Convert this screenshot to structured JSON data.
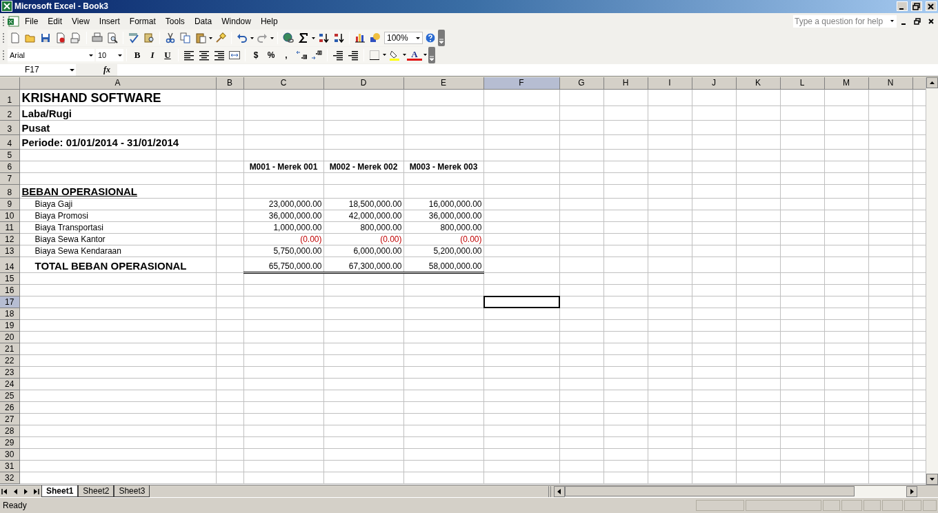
{
  "window": {
    "title": "Microsoft Excel - Book3"
  },
  "menu": [
    {
      "label": "File"
    },
    {
      "label": "Edit"
    },
    {
      "label": "View"
    },
    {
      "label": "Insert"
    },
    {
      "label": "Format"
    },
    {
      "label": "Tools"
    },
    {
      "label": "Data"
    },
    {
      "label": "Window"
    },
    {
      "label": "Help"
    }
  ],
  "help_box": {
    "placeholder": "Type a question for help"
  },
  "standard_toolbar": {
    "zoom": "100%"
  },
  "formatting_toolbar": {
    "font": "Arial",
    "size": "10",
    "buttons": [
      {
        "label": "B",
        "kind": "bold"
      },
      {
        "label": "I",
        "kind": "italic"
      },
      {
        "label": "U",
        "kind": "underline"
      },
      {
        "label": "$",
        "kind": "plain"
      },
      {
        "label": "%",
        "kind": "plain"
      },
      {
        "label": ",",
        "kind": "plain"
      },
      {
        "label": "A",
        "kind": "font_color"
      }
    ]
  },
  "formula_bar": {
    "name_box": "F17",
    "function_label": "fx"
  },
  "sheet": {
    "columns": [
      {
        "label": "A",
        "selected": false
      },
      {
        "label": "B",
        "selected": false
      },
      {
        "label": "C",
        "selected": false
      },
      {
        "label": "D",
        "selected": false
      },
      {
        "label": "E",
        "selected": false
      },
      {
        "label": "F",
        "selected": true
      },
      {
        "label": "G",
        "selected": false
      },
      {
        "label": "H",
        "selected": false
      },
      {
        "label": "I",
        "selected": false
      },
      {
        "label": "J",
        "selected": false
      },
      {
        "label": "K",
        "selected": false
      },
      {
        "label": "L",
        "selected": false
      },
      {
        "label": "M",
        "selected": false
      },
      {
        "label": "N",
        "selected": false
      }
    ],
    "rows": [
      {
        "number": "1",
        "kind": "title",
        "selected": false,
        "label": "KRISHAND SOFTWARE"
      },
      {
        "number": "2",
        "kind": "subtitle",
        "selected": false,
        "label": "Laba/Rugi"
      },
      {
        "number": "3",
        "kind": "subtitle",
        "selected": false,
        "label": "Pusat"
      },
      {
        "number": "4",
        "kind": "subtitle",
        "selected": false,
        "label": "Periode: 01/01/2014 - 31/01/2014"
      },
      {
        "number": "5",
        "kind": "empty",
        "selected": false
      },
      {
        "number": "6",
        "kind": "brand_header",
        "selected": false,
        "values": [
          {
            "text": "M001 - Merek 001",
            "negative": false
          },
          {
            "text": "M002 - Merek 002",
            "negative": false
          },
          {
            "text": "M003 - Merek 003",
            "negative": false
          }
        ]
      },
      {
        "number": "7",
        "kind": "empty",
        "selected": false
      },
      {
        "number": "8",
        "kind": "section",
        "selected": false,
        "label": "BEBAN OPERASIONAL"
      },
      {
        "number": "9",
        "kind": "item",
        "selected": false,
        "label": "Biaya Gaji",
        "values": [
          {
            "text": "23,000,000.00",
            "negative": false
          },
          {
            "text": "18,500,000.00",
            "negative": false
          },
          {
            "text": "16,000,000.00",
            "negative": false
          }
        ]
      },
      {
        "number": "10",
        "kind": "item",
        "selected": false,
        "label": "Biaya Promosi",
        "values": [
          {
            "text": "36,000,000.00",
            "negative": false
          },
          {
            "text": "42,000,000.00",
            "negative": false
          },
          {
            "text": "36,000,000.00",
            "negative": false
          }
        ]
      },
      {
        "number": "11",
        "kind": "item",
        "selected": false,
        "label": "Biaya Transportasi",
        "values": [
          {
            "text": "1,000,000.00",
            "negative": false
          },
          {
            "text": "800,000.00",
            "negative": false
          },
          {
            "text": "800,000.00",
            "negative": false
          }
        ]
      },
      {
        "number": "12",
        "kind": "item",
        "selected": false,
        "label": "Biaya Sewa Kantor",
        "values": [
          {
            "text": "(0.00)",
            "negative": true
          },
          {
            "text": "(0.00)",
            "negative": true
          },
          {
            "text": "(0.00)",
            "negative": true
          }
        ]
      },
      {
        "number": "13",
        "kind": "item",
        "selected": false,
        "label": "Biaya Sewa Kendaraan",
        "values": [
          {
            "text": "5,750,000.00",
            "negative": false
          },
          {
            "text": "6,000,000.00",
            "negative": false
          },
          {
            "text": "5,200,000.00",
            "negative": false
          }
        ]
      },
      {
        "number": "14",
        "kind": "total",
        "selected": false,
        "label": "TOTAL BEBAN OPERASIONAL",
        "values": [
          {
            "text": "65,750,000.00",
            "negative": false
          },
          {
            "text": "67,300,000.00",
            "negative": false
          },
          {
            "text": "58,000,000.00",
            "negative": false
          }
        ]
      },
      {
        "number": "15",
        "kind": "empty",
        "selected": false
      },
      {
        "number": "16",
        "kind": "empty",
        "selected": false
      },
      {
        "number": "17",
        "kind": "empty",
        "selected": true
      },
      {
        "number": "18",
        "kind": "empty",
        "selected": false
      },
      {
        "number": "19",
        "kind": "empty",
        "selected": false
      },
      {
        "number": "20",
        "kind": "empty",
        "selected": false
      },
      {
        "number": "21",
        "kind": "empty",
        "selected": false
      },
      {
        "number": "22",
        "kind": "empty",
        "selected": false
      },
      {
        "number": "23",
        "kind": "empty",
        "selected": false
      },
      {
        "number": "24",
        "kind": "empty",
        "selected": false
      },
      {
        "number": "25",
        "kind": "empty",
        "selected": false
      },
      {
        "number": "26",
        "kind": "empty",
        "selected": false
      },
      {
        "number": "27",
        "kind": "empty",
        "selected": false
      },
      {
        "number": "28",
        "kind": "empty",
        "selected": false
      },
      {
        "number": "29",
        "kind": "empty",
        "selected": false
      },
      {
        "number": "30",
        "kind": "empty",
        "selected": false
      },
      {
        "number": "31",
        "kind": "empty",
        "selected": false
      },
      {
        "number": "32",
        "kind": "empty",
        "selected": false
      }
    ]
  },
  "sheet_tabs": [
    {
      "label": "Sheet1",
      "selected": true
    },
    {
      "label": "Sheet2",
      "selected": false
    },
    {
      "label": "Sheet3",
      "selected": false
    }
  ],
  "status_bar": {
    "text": "Ready"
  }
}
